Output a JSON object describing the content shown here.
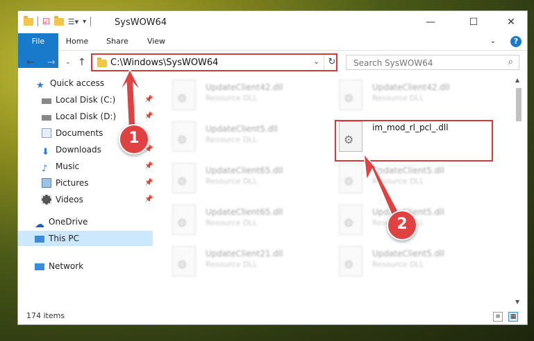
{
  "window": {
    "title": "SysWOW64",
    "minimize": "—",
    "maximize": "☐",
    "close": "✕"
  },
  "ribbon": {
    "tabs": [
      "File",
      "Home",
      "Share",
      "View"
    ],
    "help": "?"
  },
  "address": {
    "path": "C:\\Windows\\SysWOW64",
    "search_placeholder": "Search SysWOW64"
  },
  "nav": {
    "items": [
      {
        "label": "Quick access",
        "icon": "star-icon",
        "pinned": false
      },
      {
        "label": "Local Disk (C:)",
        "icon": "drive-icon",
        "pinned": true
      },
      {
        "label": "Local Disk (D:)",
        "icon": "drive-icon",
        "pinned": true
      },
      {
        "label": "Documents",
        "icon": "documents-icon",
        "pinned": true
      },
      {
        "label": "Downloads",
        "icon": "download-icon",
        "pinned": true
      },
      {
        "label": "Music",
        "icon": "music-icon",
        "pinned": true
      },
      {
        "label": "Pictures",
        "icon": "pictures-icon",
        "pinned": true
      },
      {
        "label": "Videos",
        "icon": "videos-icon",
        "pinned": true
      },
      {
        "label": "OneDrive",
        "icon": "cloud-icon",
        "pinned": false
      },
      {
        "label": "This PC",
        "icon": "computer-icon",
        "pinned": false
      },
      {
        "label": "Network",
        "icon": "network-icon",
        "pinned": false
      }
    ]
  },
  "files": [
    {
      "name": "UpdateClient42.dll",
      "type": "Resource DLL"
    },
    {
      "name": "UpdateClient42.dll",
      "type": "Resource DLL"
    },
    {
      "name": "UpdateClient5.dll",
      "type": "Resource DLL"
    },
    {
      "name": "im_mod_rl_pcl_.dll",
      "type": ""
    },
    {
      "name": "UpdateClient65.dll",
      "type": "Resource DLL"
    },
    {
      "name": "UpdateClient5.dll",
      "type": "Resource DLL"
    },
    {
      "name": "UpdateClient65.dll",
      "type": "Resource DLL"
    },
    {
      "name": "UpdateClient5.dll",
      "type": "Resource DLL"
    },
    {
      "name": "UpdateClient21.dll",
      "type": "Resource DLL"
    },
    {
      "name": "UpdateClient5.dll",
      "type": "Resource DLL"
    }
  ],
  "status": {
    "item_count": "174 items"
  },
  "annotations": {
    "badge1": "1",
    "badge2": "2",
    "accent": "#d9383a"
  }
}
